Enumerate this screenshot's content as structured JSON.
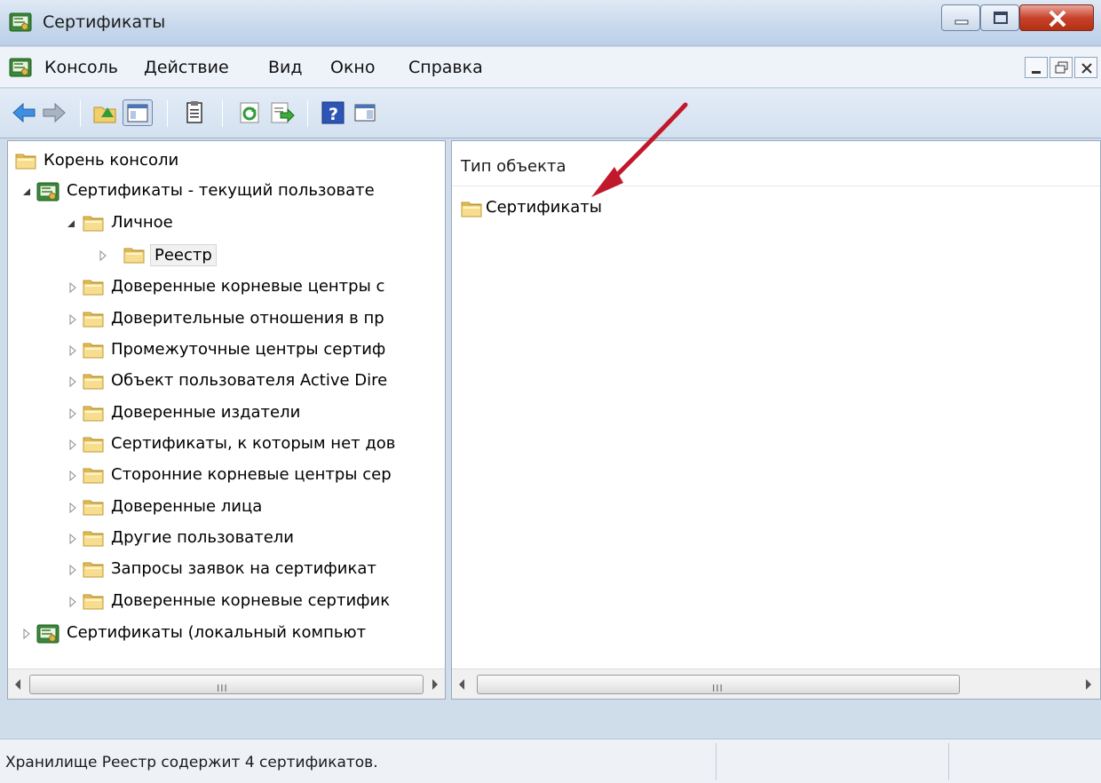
{
  "window": {
    "title": "Сертификаты"
  },
  "menu": {
    "items": [
      "Консоль",
      "Действие",
      "Вид",
      "Окно",
      "Справка"
    ]
  },
  "toolbar": {
    "buttons": [
      "back-arrow-icon",
      "forward-arrow-icon",
      "up-folder-icon",
      "show-hide-tree-icon",
      "properties-icon",
      "refresh-icon",
      "export-list-icon",
      "help-icon",
      "show-hide-action-pane-icon"
    ]
  },
  "tree": {
    "root": "Корень консоли",
    "current_user": "Сертификаты - текущий пользовате",
    "personal": "Личное",
    "registry": "Реестр",
    "stores": [
      "Доверенные корневые центры с",
      "Доверительные отношения в пр",
      "Промежуточные центры сертиф",
      "Объект пользователя Active Dire",
      "Доверенные издатели",
      "Сертификаты, к которым нет дов",
      "Сторонние корневые центры сер",
      "Доверенные лица",
      "Другие пользователи",
      "Запросы заявок на сертификат",
      "Доверенные корневые сертифик"
    ],
    "local_computer": "Сертификаты (локальный компьют"
  },
  "list": {
    "column_header": "Тип объекта",
    "items": [
      "Сертификаты"
    ]
  },
  "scrollbar": {
    "grip": "III"
  },
  "status": {
    "text": "Хранилище Реестр содержит 4 сертификатов."
  },
  "colors": {
    "annotation_arrow": "#c2182b",
    "folder": "#f4d67a",
    "title_bar": "#c9d9ec"
  }
}
